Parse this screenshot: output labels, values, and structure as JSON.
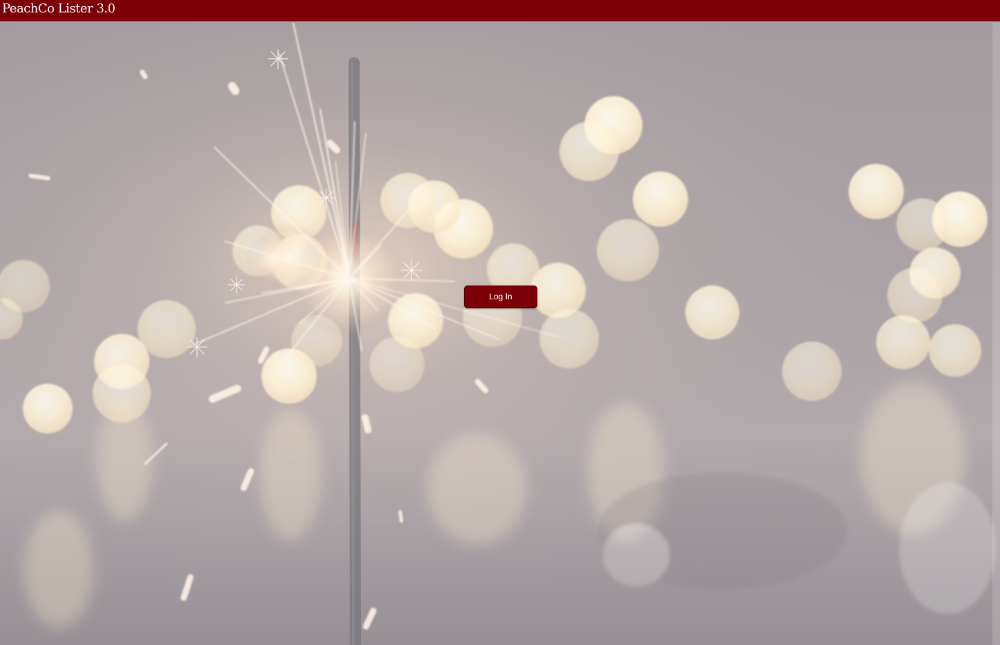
{
  "header": {
    "title": "PeachCo Lister 3.0"
  },
  "login": {
    "button_label": "Log In"
  },
  "colors": {
    "brand": "#7d0008",
    "background": "#a9a1a6",
    "bokeh": "#fff5df"
  },
  "background_image": {
    "subject": "sparkler and bokeh lights photo"
  }
}
